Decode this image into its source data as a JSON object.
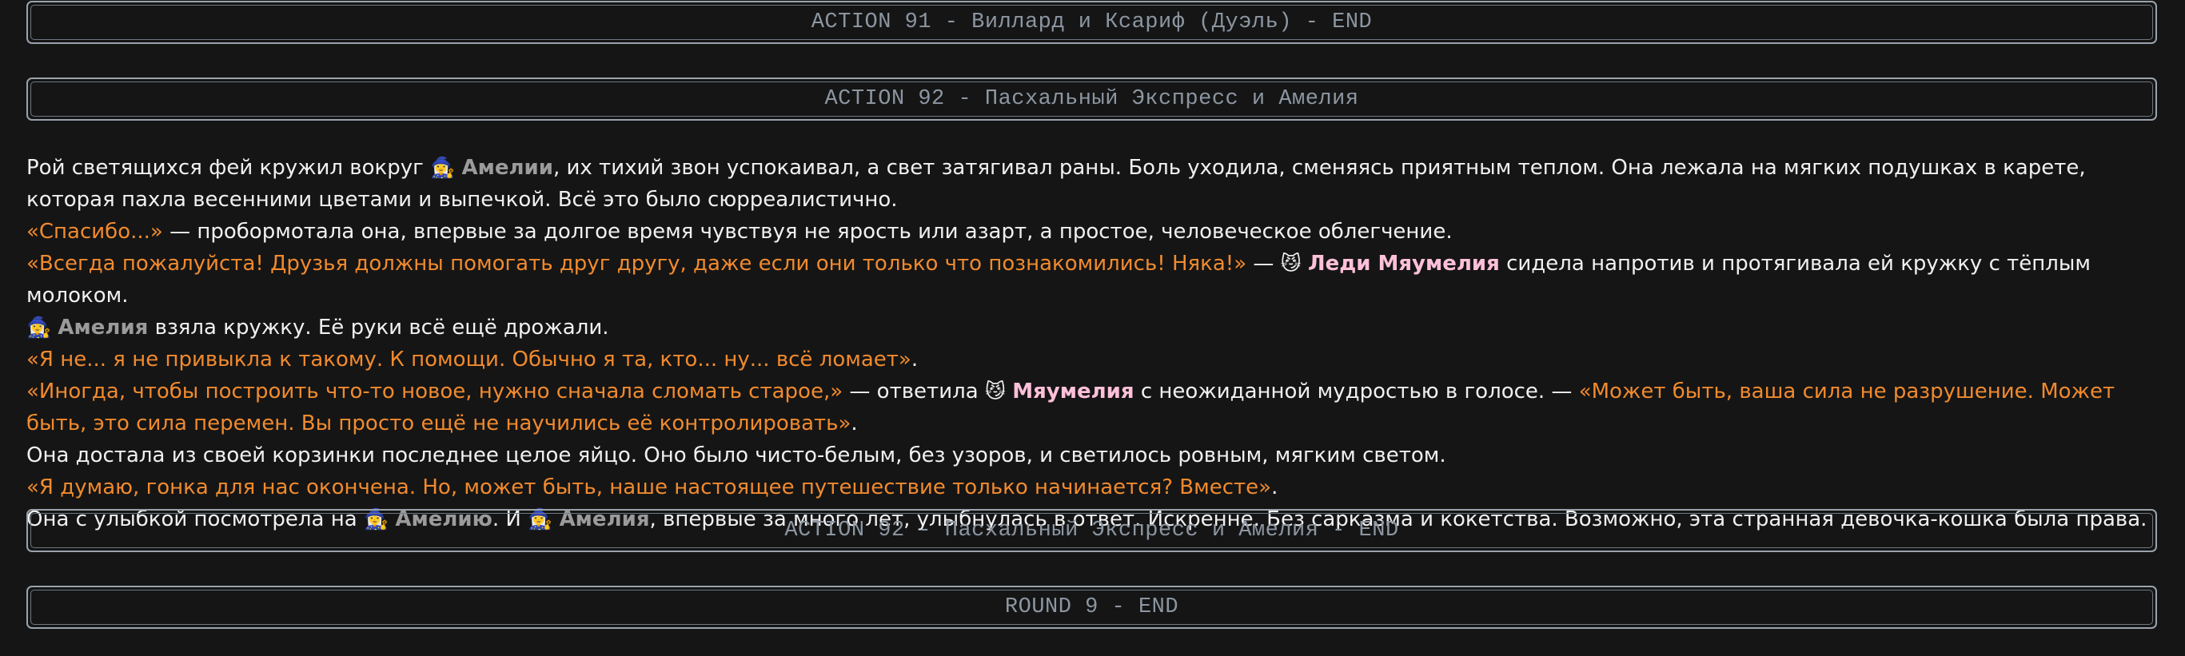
{
  "banners": {
    "action91_end": "ACTION 91 - Виллард и Ксариф (Дуэль) - END",
    "action92_start": "ACTION 92 - Пасхальный Экспресс и Амелия",
    "action92_end": "ACTION 92 - Пасхальный Экспресс и Амелия - END",
    "round9_end": "ROUND 9 - END"
  },
  "icons": {
    "amelia": "🧙‍♀️",
    "meow": "😼"
  },
  "colors": {
    "quote": "#f08a2e",
    "amelia_name": "#9b9b9b",
    "meow_name": "#ffc0d9"
  },
  "story": {
    "p1": {
      "t1": "Рой светящихся фей кружил вокруг ",
      "name": "Амелии",
      "t2": ", их тихий звон успокаивал, а свет затягивал раны. Боль уходила, сменяясь приятным теплом. Она лежала на мягких подушках в карете, которая пахла весенними цветами и выпечкой. Всё это было сюрреалистично."
    },
    "p2": {
      "quote": "«Спасибо...»",
      "t1": " — пробормотала она, впервые за долгое время чувствуя не ярость или азарт, а простое, человеческое облегчение."
    },
    "p3": {
      "quote": "«Всегда пожалуйста! Друзья должны помогать друг другу, даже если они только что познакомились! Няка!»",
      "t1": " — ",
      "name": "Леди Мяумелия",
      "t2": " сидела напротив и протягивала ей кружку с тёплым молоком."
    },
    "p4": {
      "name": "Амелия",
      "t1": " взяла кружку. Её руки всё ещё дрожали."
    },
    "p5": {
      "quote": "«Я не... я не привыкла к такому. К помощи. Обычно я та, кто... ну... всё ломает»",
      "t1": "."
    },
    "p6": {
      "quote1": "«Иногда, чтобы построить что-то новое, нужно сначала сломать старое,»",
      "t1": " — ответила ",
      "name": "Мяумелия",
      "t2": " с неожиданной мудростью в голосе. — ",
      "quote2": "«Может быть, ваша сила не разрушение. Может быть, это сила перемен. Вы просто ещё не научились её контролировать»",
      "t3": "."
    },
    "p7": {
      "t1": "Она достала из своей корзинки последнее целое яйцо. Оно было чисто-белым, без узоров, и светилось ровным, мягким светом."
    },
    "p8": {
      "quote": "«Я думаю, гонка для нас окончена. Но, может быть, наше настоящее путешествие только начинается? Вместе»",
      "t1": "."
    },
    "p9": {
      "t1": "Она с улыбкой посмотрела на ",
      "name1": "Амелию",
      "t2": ". И ",
      "name2": "Амелия",
      "t3": ", впервые за много лет, улыбнулась в ответ. Искренне. Без сарказма и кокетства. Возможно, эта странная девочка-кошка была права."
    }
  }
}
